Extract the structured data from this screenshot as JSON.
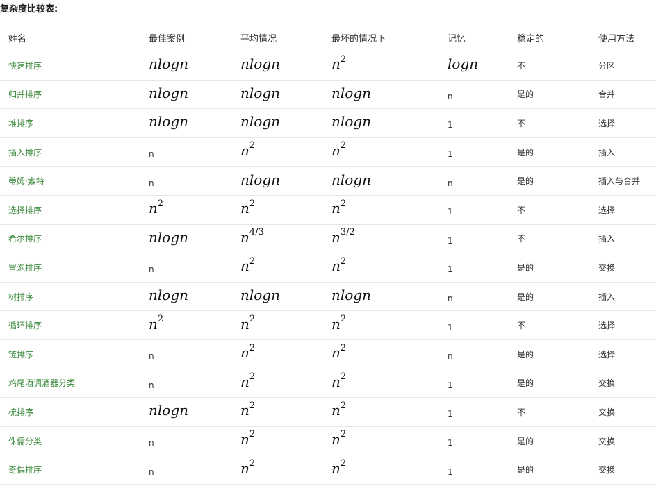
{
  "heading": "复杂度比较表:",
  "columns": [
    "姓名",
    "最佳案例",
    "平均情况",
    "最坏的情况下",
    "记忆",
    "稳定的",
    "使用方法"
  ],
  "rows": [
    {
      "name": "快速排序",
      "best": {
        "kind": "math",
        "base": "nlogn"
      },
      "average": {
        "kind": "math",
        "base": "nlogn"
      },
      "worst": {
        "kind": "math",
        "base": "n",
        "exp": "2"
      },
      "memory": {
        "kind": "math",
        "base": "logn"
      },
      "stable": "不",
      "method": "分区"
    },
    {
      "name": "归并排序",
      "best": {
        "kind": "math",
        "base": "nlogn"
      },
      "average": {
        "kind": "math",
        "base": "nlogn"
      },
      "worst": {
        "kind": "math",
        "base": "nlogn"
      },
      "memory": {
        "kind": "plain",
        "text": "n"
      },
      "stable": "是的",
      "method": "合并"
    },
    {
      "name": "堆排序",
      "best": {
        "kind": "math",
        "base": "nlogn"
      },
      "average": {
        "kind": "math",
        "base": "nlogn"
      },
      "worst": {
        "kind": "math",
        "base": "nlogn"
      },
      "memory": {
        "kind": "plain",
        "text": "1"
      },
      "stable": "不",
      "method": "选择"
    },
    {
      "name": "插入排序",
      "best": {
        "kind": "plain",
        "text": "n"
      },
      "average": {
        "kind": "math",
        "base": "n",
        "exp": "2"
      },
      "worst": {
        "kind": "math",
        "base": "n",
        "exp": "2"
      },
      "memory": {
        "kind": "plain",
        "text": "1"
      },
      "stable": "是的",
      "method": "插入"
    },
    {
      "name": "蒂姆·索特",
      "best": {
        "kind": "plain",
        "text": "n"
      },
      "average": {
        "kind": "math",
        "base": "nlogn"
      },
      "worst": {
        "kind": "math",
        "base": "nlogn"
      },
      "memory": {
        "kind": "plain",
        "text": "n"
      },
      "stable": "是的",
      "method": "插入与合并"
    },
    {
      "name": "选择排序",
      "best": {
        "kind": "math",
        "base": "n",
        "exp": "2"
      },
      "average": {
        "kind": "math",
        "base": "n",
        "exp": "2"
      },
      "worst": {
        "kind": "math",
        "base": "n",
        "exp": "2"
      },
      "memory": {
        "kind": "plain",
        "text": "1"
      },
      "stable": "不",
      "method": "选择"
    },
    {
      "name": "希尔排序",
      "best": {
        "kind": "math",
        "base": "nlogn"
      },
      "average": {
        "kind": "math",
        "base": "n",
        "exp": "4/3"
      },
      "worst": {
        "kind": "math",
        "base": "n",
        "exp": "3/2"
      },
      "memory": {
        "kind": "plain",
        "text": "1"
      },
      "stable": "不",
      "method": "插入"
    },
    {
      "name": "冒泡排序",
      "best": {
        "kind": "plain",
        "text": "n"
      },
      "average": {
        "kind": "math",
        "base": "n",
        "exp": "2"
      },
      "worst": {
        "kind": "math",
        "base": "n",
        "exp": "2"
      },
      "memory": {
        "kind": "plain",
        "text": "1"
      },
      "stable": "是的",
      "method": "交换"
    },
    {
      "name": "树排序",
      "best": {
        "kind": "math",
        "base": "nlogn"
      },
      "average": {
        "kind": "math",
        "base": "nlogn"
      },
      "worst": {
        "kind": "math",
        "base": "nlogn"
      },
      "memory": {
        "kind": "plain",
        "text": "n"
      },
      "stable": "是的",
      "method": "插入"
    },
    {
      "name": "循环排序",
      "best": {
        "kind": "math",
        "base": "n",
        "exp": "2"
      },
      "average": {
        "kind": "math",
        "base": "n",
        "exp": "2"
      },
      "worst": {
        "kind": "math",
        "base": "n",
        "exp": "2"
      },
      "memory": {
        "kind": "plain",
        "text": "1"
      },
      "stable": "不",
      "method": "选择"
    },
    {
      "name": "链排序",
      "best": {
        "kind": "plain",
        "text": "n"
      },
      "average": {
        "kind": "math",
        "base": "n",
        "exp": "2"
      },
      "worst": {
        "kind": "math",
        "base": "n",
        "exp": "2"
      },
      "memory": {
        "kind": "plain",
        "text": "n"
      },
      "stable": "是的",
      "method": "选择"
    },
    {
      "name": "鸡尾酒调酒器分类",
      "best": {
        "kind": "plain",
        "text": "n"
      },
      "average": {
        "kind": "math",
        "base": "n",
        "exp": "2"
      },
      "worst": {
        "kind": "math",
        "base": "n",
        "exp": "2"
      },
      "memory": {
        "kind": "plain",
        "text": "1"
      },
      "stable": "是的",
      "method": "交换"
    },
    {
      "name": "梳排序",
      "best": {
        "kind": "math",
        "base": "nlogn"
      },
      "average": {
        "kind": "math",
        "base": "n",
        "exp": "2"
      },
      "worst": {
        "kind": "math",
        "base": "n",
        "exp": "2"
      },
      "memory": {
        "kind": "plain",
        "text": "1"
      },
      "stable": "不",
      "method": "交换"
    },
    {
      "name": "侏儒分类",
      "best": {
        "kind": "plain",
        "text": "n"
      },
      "average": {
        "kind": "math",
        "base": "n",
        "exp": "2"
      },
      "worst": {
        "kind": "math",
        "base": "n",
        "exp": "2"
      },
      "memory": {
        "kind": "plain",
        "text": "1"
      },
      "stable": "是的",
      "method": "交换"
    },
    {
      "name": "奇偶排序",
      "best": {
        "kind": "plain",
        "text": "n"
      },
      "average": {
        "kind": "math",
        "base": "n",
        "exp": "2"
      },
      "worst": {
        "kind": "math",
        "base": "n",
        "exp": "2"
      },
      "memory": {
        "kind": "plain",
        "text": "1"
      },
      "stable": "是的",
      "method": "交换"
    }
  ]
}
